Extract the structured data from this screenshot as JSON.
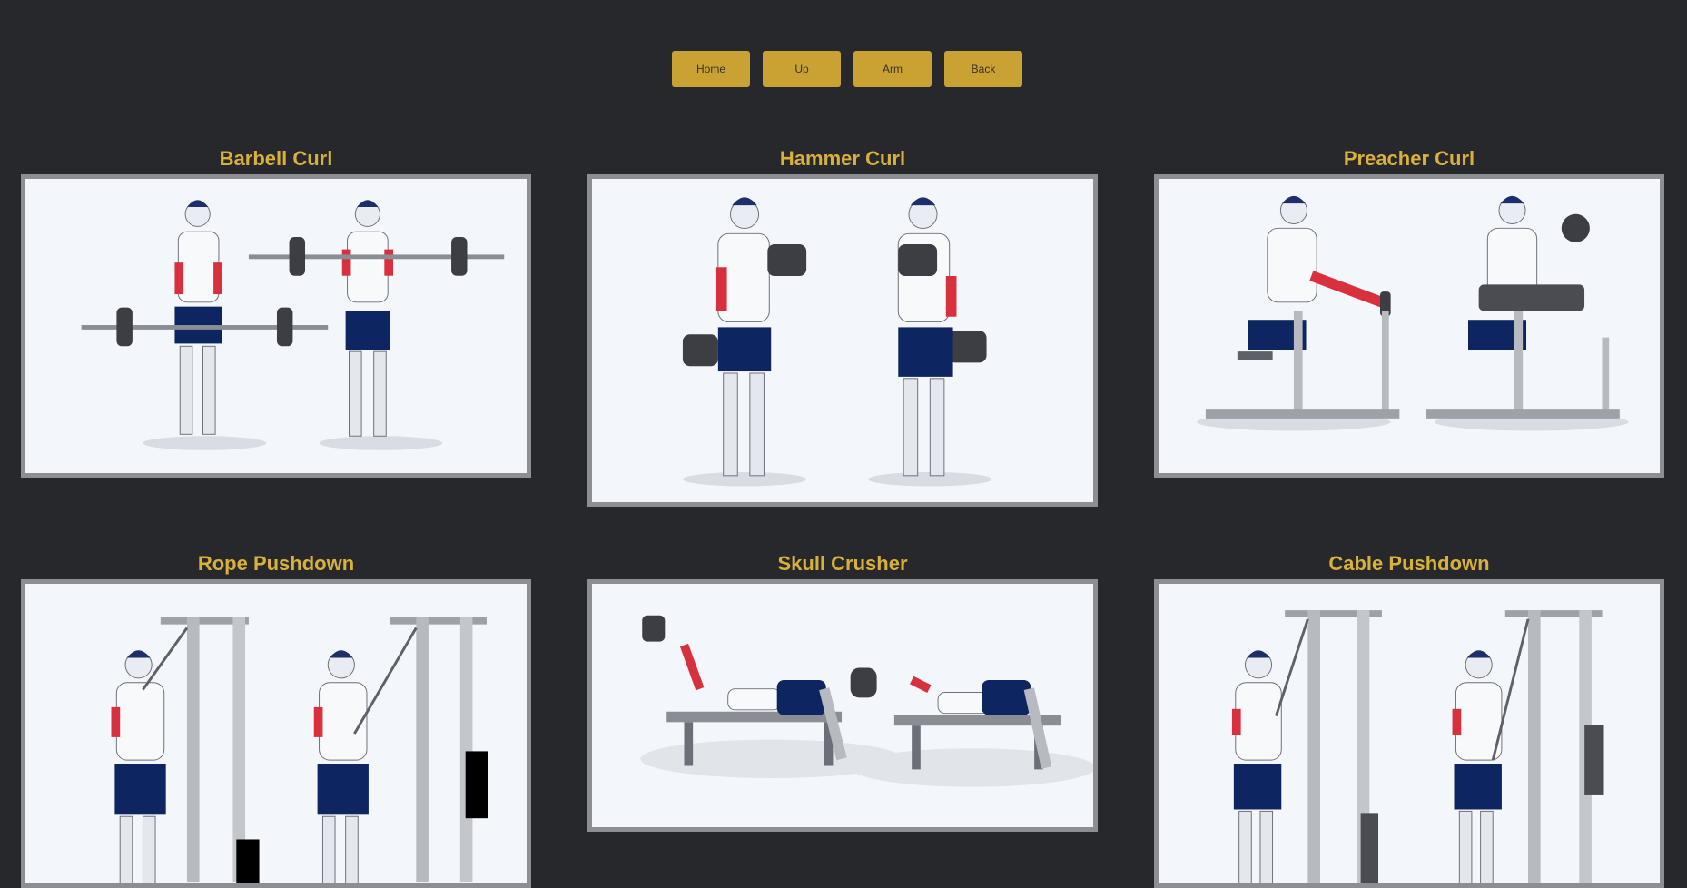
{
  "nav": {
    "buttons": [
      {
        "label": "Home"
      },
      {
        "label": "Up"
      },
      {
        "label": "Arm"
      },
      {
        "label": "Back"
      }
    ]
  },
  "exercises": [
    {
      "title": "Barbell Curl"
    },
    {
      "title": "Hammer Curl"
    },
    {
      "title": "Preacher Curl"
    },
    {
      "title": "Rope Pushdown"
    },
    {
      "title": "Skull Crusher"
    },
    {
      "title": "Cable Pushdown"
    }
  ],
  "colors": {
    "background": "#27282c",
    "accent": "#c9a233",
    "title": "#d9b13a",
    "frame": "#8d8e93",
    "image_bg": "#f3f6fb",
    "shorts": "#0d2560",
    "muscle": "#d8303d"
  }
}
